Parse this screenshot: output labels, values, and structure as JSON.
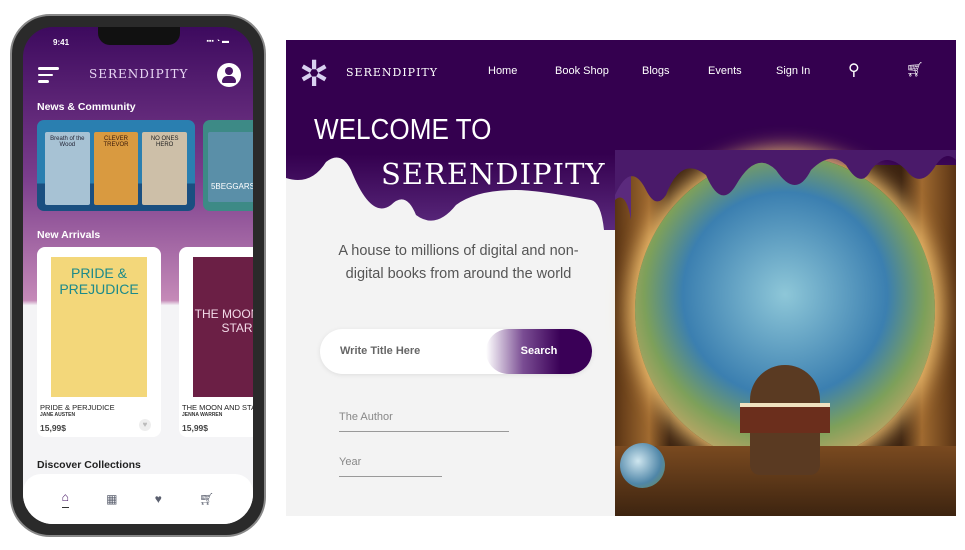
{
  "mobile": {
    "status_time": "9:41",
    "status_icons": "▪▪▪ ◔ ▬",
    "app_title": "SERENDIPITY",
    "news_heading": "News & Community",
    "news_books": [
      "Breath of the Wood",
      "CLEVER TREVOR",
      "NO ONES HERO",
      "5BEGGARS"
    ],
    "arrivals_heading": "New Arrivals",
    "cards": [
      {
        "title": "PRIDE & PERJUDICE",
        "author": "JANE AUSTEN",
        "price": "15,99$",
        "cover_text": "PRIDE & PREJUDICE"
      },
      {
        "title": "THE MOON AND STARS",
        "author": "JENNA WARREN",
        "price": "15,99$",
        "cover_text": "THE MOON AND STARS"
      }
    ],
    "collections_heading": "Discover Collections",
    "tabs": [
      "home-icon",
      "grid-icon",
      "heart-icon",
      "cart-icon"
    ],
    "active_tab": "home"
  },
  "web": {
    "brand": "SERENDIPITY",
    "nav": [
      "Home",
      "Book Shop",
      "Blogs",
      "Events",
      "Sign In"
    ],
    "welcome": "WELCOME TO",
    "hero_brand": "SERENDIPITY",
    "tagline": "A house to millions of digital and non-digital books from around the world",
    "search_placeholder": "Write Title Here",
    "search_button": "Search",
    "author_placeholder": "The Author",
    "year_placeholder": "Year"
  },
  "colors": {
    "primary": "#34004f",
    "accent": "#c58ab8"
  }
}
